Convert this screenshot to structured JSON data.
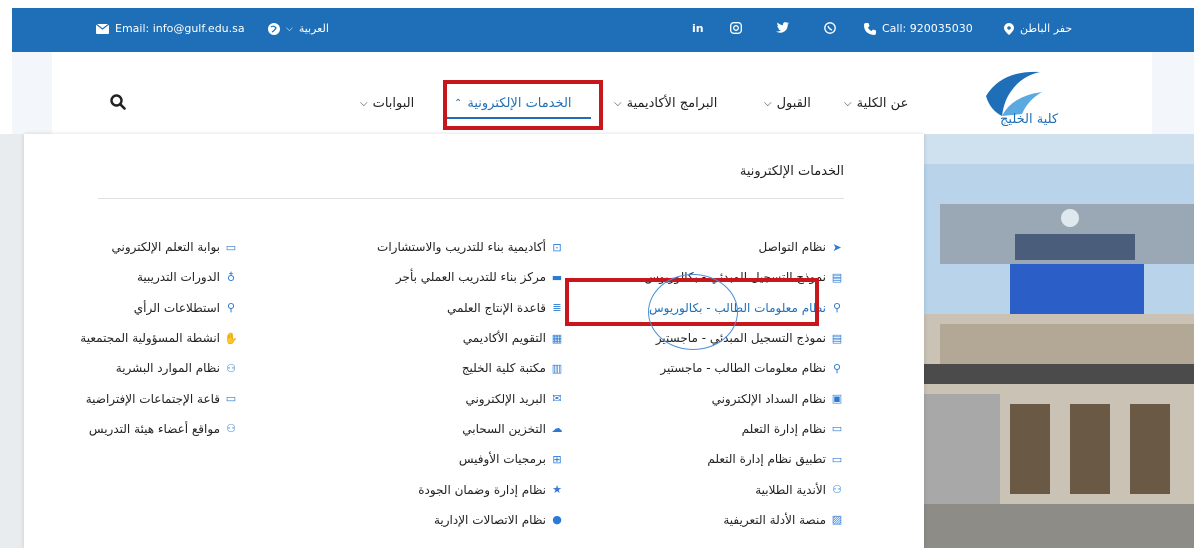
{
  "topbar": {
    "email": "Email: info@gulf.edu.sa",
    "language": "العربية",
    "social": [
      "in",
      "◎",
      "twitter",
      "whatsapp"
    ],
    "call": "Call: 920035030",
    "location": "حفر الباطن"
  },
  "nav": {
    "items": [
      {
        "label": "عن الكلية"
      },
      {
        "label": "القبول"
      },
      {
        "label": "البرامج الأكاديمية"
      },
      {
        "label": "الخدمات الإلكترونية",
        "active": true
      },
      {
        "label": "البوابات"
      }
    ]
  },
  "logo": {
    "text": "كلية الخليج"
  },
  "panel": {
    "title": "الخدمات الإلكترونية",
    "col1": [
      {
        "label": "نظام التواصل",
        "icon": "send-icon"
      },
      {
        "label": "نموذج التسجيل المبدئي - بكالوريوس",
        "icon": "form-icon"
      },
      {
        "label": "نظام معلومات الطالب - بكالوريوس",
        "icon": "person-icon",
        "highlight": true
      },
      {
        "label": "نموذج التسجيل المبدئي - ماجستير",
        "icon": "form-icon"
      },
      {
        "label": "نظام معلومات الطالب - ماجستير",
        "icon": "person-icon"
      },
      {
        "label": "نظام السداد الإلكتروني",
        "icon": "payment-icon"
      },
      {
        "label": "نظام إدارة التعلم",
        "icon": "teacher-icon"
      },
      {
        "label": "تطبيق نظام إدارة التعلم",
        "icon": "teacher-icon"
      },
      {
        "label": "الأندية الطلابية",
        "icon": "group-icon"
      },
      {
        "label": "منصة الأدلة التعريفية",
        "icon": "image-icon"
      }
    ],
    "col2": [
      {
        "label": "أكاديمية بناء للتدريب والاستشارات",
        "icon": "training-icon"
      },
      {
        "label": "مركز بناء للتدريب العملي بأجر",
        "icon": "card-icon"
      },
      {
        "label": "قاعدة الإنتاج العلمي",
        "icon": "database-icon"
      },
      {
        "label": "التقويم الأكاديمي",
        "icon": "calendar-icon"
      },
      {
        "label": "مكتبة كلية الخليج",
        "icon": "book-icon"
      },
      {
        "label": "البريد الإلكتروني",
        "icon": "mail-icon"
      },
      {
        "label": "التخزين السحابي",
        "icon": "cloud-icon"
      },
      {
        "label": "برمجيات الأوفيس",
        "icon": "windows-icon"
      },
      {
        "label": "نظام إدارة وضمان الجودة",
        "icon": "star-icon"
      },
      {
        "label": "نظام الاتصالات الإدارية",
        "icon": "chat-icon"
      }
    ],
    "col3": [
      {
        "label": "بوابة التعلم الإلكتروني",
        "icon": "laptop-icon"
      },
      {
        "label": "الدورات التدريبية",
        "icon": "certificate-icon"
      },
      {
        "label": "استطلاعات الرأي",
        "icon": "search-icon"
      },
      {
        "label": "انشطة المسؤولية المجتمعية",
        "icon": "handshake-icon"
      },
      {
        "label": "نظام الموارد البشرية",
        "icon": "users-icon"
      },
      {
        "label": "قاعة الإجتماعات الإفتراضية",
        "icon": "screen-icon"
      },
      {
        "label": "مواقع أعضاء هيئة التدريس",
        "icon": "faculty-icon"
      }
    ]
  },
  "colors": {
    "brand": "#1e6fb8",
    "highlight": "#c8161d",
    "icon": "#2a7ad6"
  }
}
